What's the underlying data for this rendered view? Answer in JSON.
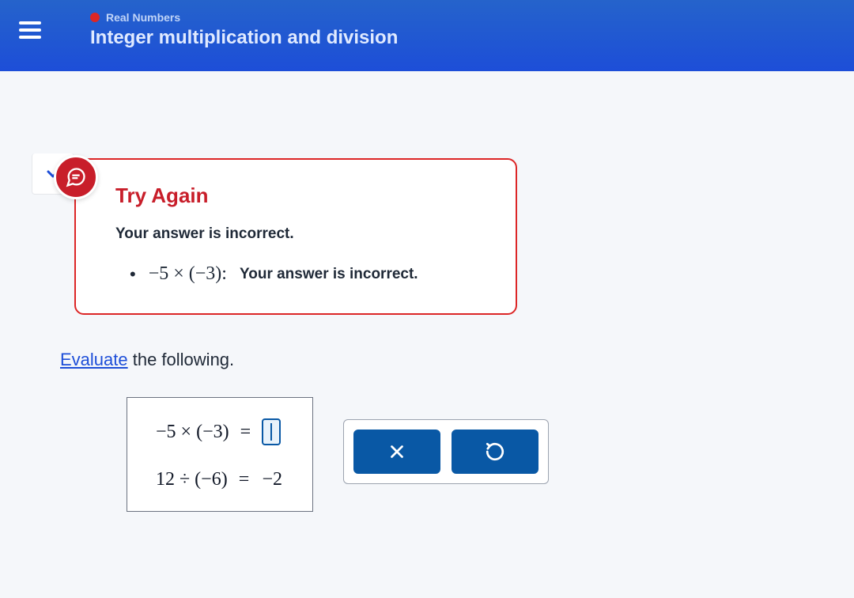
{
  "header": {
    "category": "Real Numbers",
    "title": "Integer multiplication and division"
  },
  "feedback": {
    "title": "Try Again",
    "body": "Your answer is incorrect.",
    "item_expr": "−5 × (−3):",
    "item_text": "Your answer is incorrect."
  },
  "instruction": {
    "link": "Evaluate",
    "rest": " the following."
  },
  "problems": {
    "p1": {
      "lhs": "−5 × (−3)",
      "eq": "=",
      "answer": ""
    },
    "p2": {
      "lhs": "12 ÷ (−6)",
      "eq": "=",
      "answer": "−2"
    }
  },
  "icons": {
    "hamburger": "menu",
    "chevron": "chevron-down",
    "feedback": "speech-bubble",
    "clear": "x",
    "reset": "undo"
  }
}
